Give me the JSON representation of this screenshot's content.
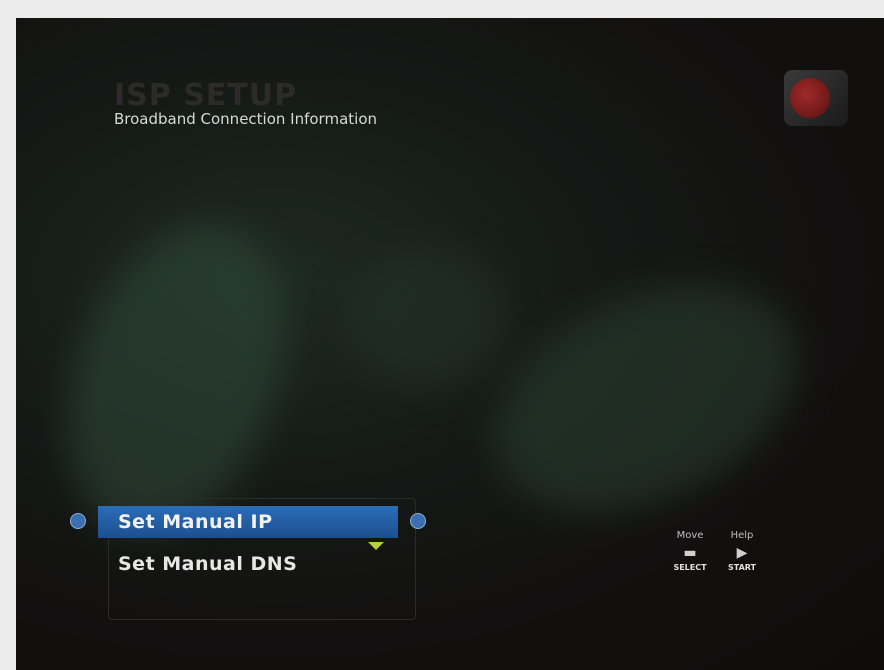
{
  "header": {
    "watermark_title": "ISP SETUP",
    "subtitle": "Broadband Connection Information"
  },
  "menu": {
    "items": [
      {
        "label": "Set Manual IP",
        "selected": true
      },
      {
        "label": "Set Manual DNS",
        "selected": false
      }
    ]
  },
  "hints": [
    {
      "label": "Move",
      "key": "SELECT"
    },
    {
      "label": "Help",
      "key": "START"
    }
  ],
  "colors": {
    "selection": "#2a6db8",
    "scroll_arrow": "#b8d040"
  }
}
